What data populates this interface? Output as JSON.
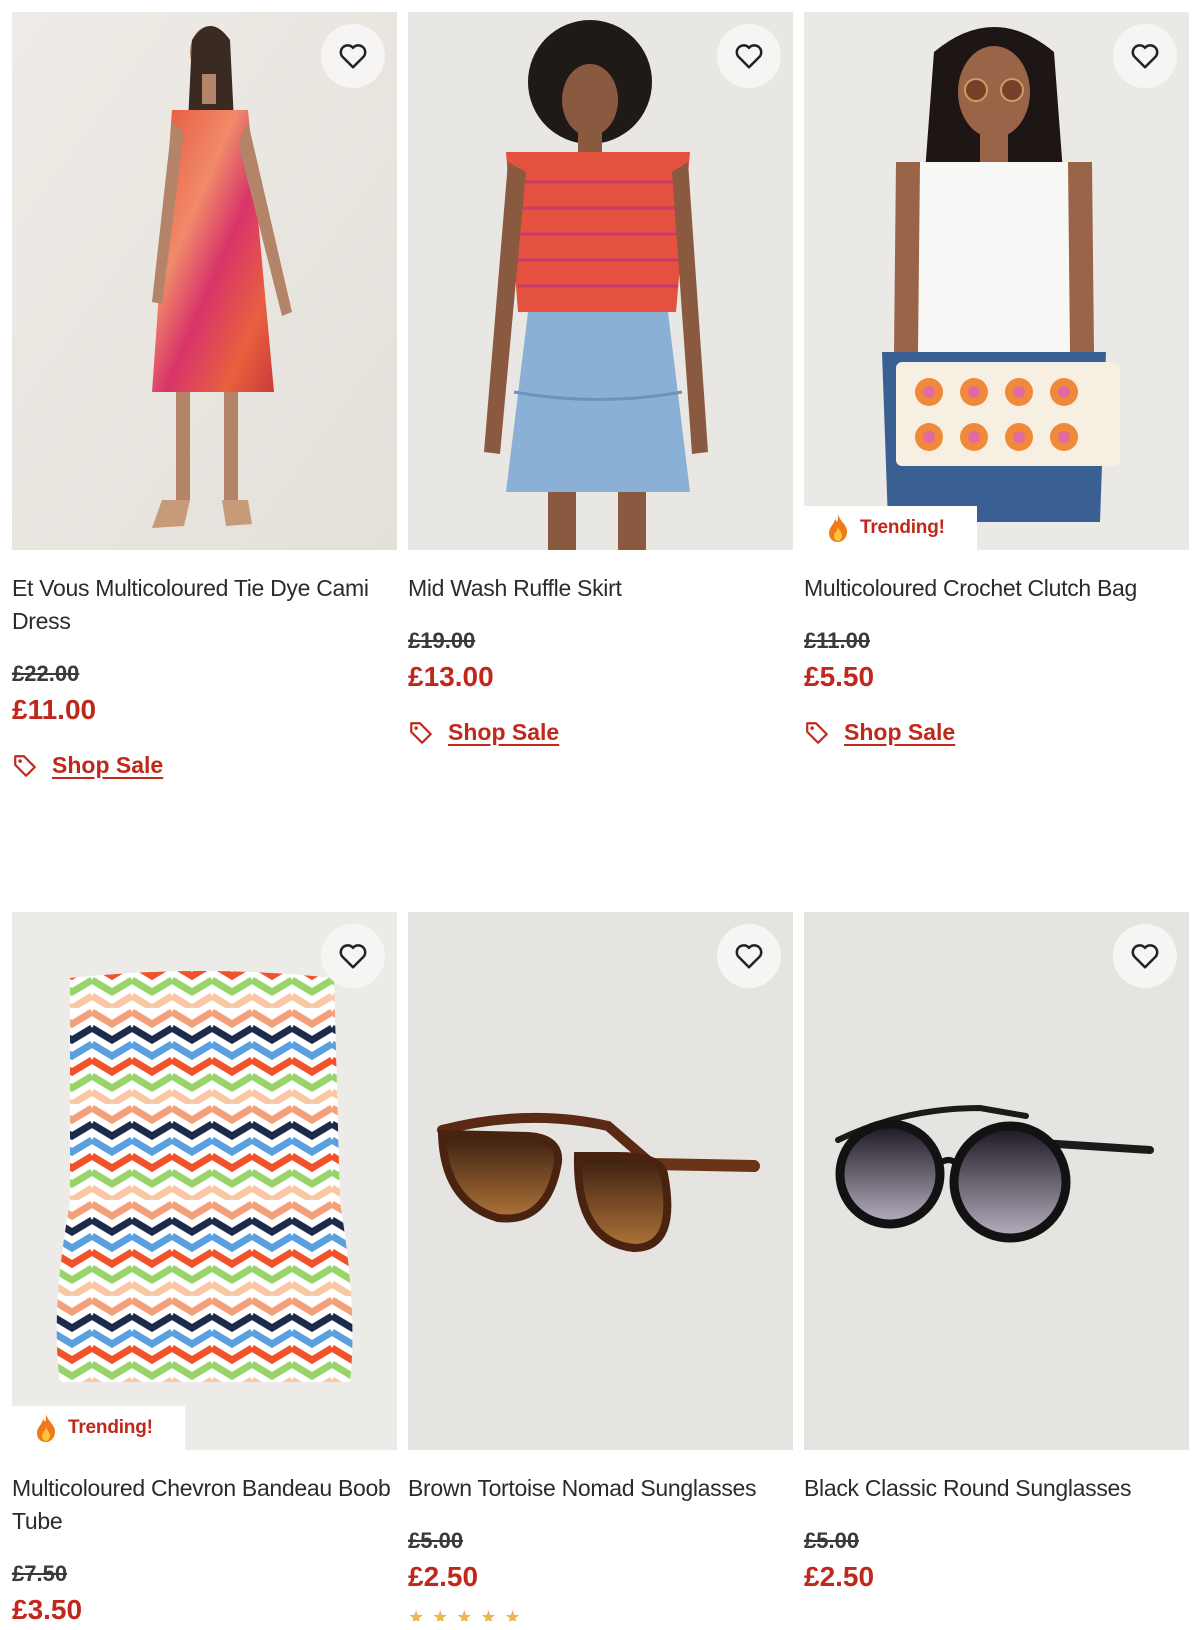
{
  "products": [
    {
      "title": "Et Vous Multicoloured Tie Dye Cami Dress",
      "was_price": "£22.00",
      "now_price": "£11.00",
      "sale_link": "Shop Sale",
      "badge": "",
      "image": "model-red-tie-dye-midi-dress"
    },
    {
      "title": "Mid Wash Ruffle Skirt",
      "was_price": "£19.00",
      "now_price": "£13.00",
      "sale_link": "Shop Sale",
      "badge": "",
      "image": "model-red-top-denim-ruffle-skirt"
    },
    {
      "title": "Multicoloured Crochet Clutch Bag",
      "was_price": "£11.00",
      "now_price": "£5.50",
      "sale_link": "Shop Sale",
      "badge": "Trending!",
      "image": "model-white-vest-crochet-clutch"
    },
    {
      "title": "Multicoloured Chevron Bandeau Boob Tube",
      "was_price": "£7.50",
      "now_price": "£3.50",
      "sale_link": "",
      "badge": "Trending!",
      "image": "chevron-bandeau-top"
    },
    {
      "title": "Brown Tortoise Nomad Sunglasses",
      "was_price": "£5.00",
      "now_price": "£2.50",
      "sale_link": "",
      "badge": "",
      "image": "brown-tortoise-sunglasses"
    },
    {
      "title": "Black Classic Round Sunglasses",
      "was_price": "£5.00",
      "now_price": "£2.50",
      "sale_link": "",
      "badge": "",
      "image": "black-round-sunglasses"
    }
  ],
  "icons": {
    "wishlist": "heart-outline-icon",
    "sale": "price-tag-icon",
    "trending": "fire-icon"
  },
  "colors": {
    "accent_red": "#c0281b",
    "image_bg": "#ecebe8"
  }
}
